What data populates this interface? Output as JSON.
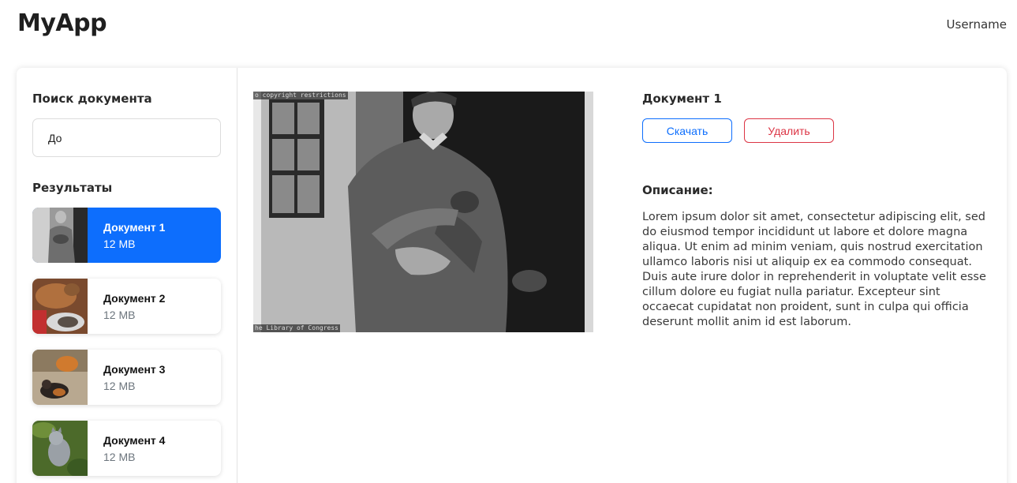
{
  "header": {
    "app_title": "MyApp",
    "username": "Username"
  },
  "sidebar": {
    "search_label": "Поиск документа",
    "search_value": "До",
    "results_label": "Результаты",
    "results": [
      {
        "title": "Документ 1",
        "size": "12 MB",
        "selected": true
      },
      {
        "title": "Документ 2",
        "size": "12 MB",
        "selected": false
      },
      {
        "title": "Документ 3",
        "size": "12 MB",
        "selected": false
      },
      {
        "title": "Документ 4",
        "size": "12 MB",
        "selected": false
      }
    ]
  },
  "preview": {
    "watermark_top": "o copyright restrictions",
    "watermark_bottom": "he Library of Congress"
  },
  "details": {
    "title": "Документ 1",
    "download_label": "Скачать",
    "delete_label": "Удалить",
    "description_label": "Описание:",
    "description_text": "Lorem ipsum dolor sit amet, consectetur adipiscing elit, sed do eiusmod tempor incididunt ut labore et dolore magna aliqua. Ut enim ad minim veniam, quis nostrud exercitation ullamco laboris nisi ut aliquip ex ea commodo consequat. Duis aute irure dolor in reprehenderit in voluptate velit esse cillum dolore eu fugiat nulla pariatur. Excepteur sint occaecat cupidatat non proident, sunt in culpa qui officia deserunt mollit anim id est laborum."
  },
  "colors": {
    "primary": "#0d6efd",
    "danger": "#dc3545",
    "muted": "#6c757d"
  }
}
